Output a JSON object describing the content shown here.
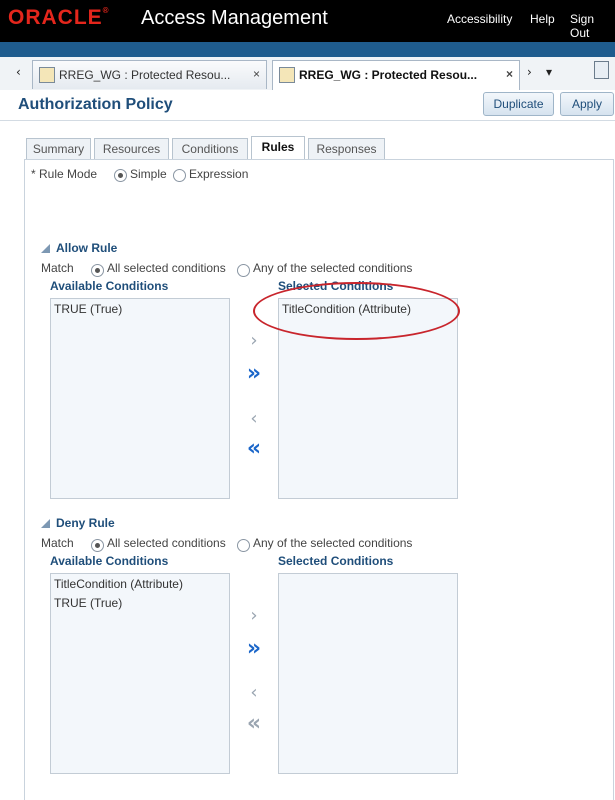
{
  "header": {
    "brand": "ORACLE",
    "product": "Access Management",
    "links": [
      "Accessibility",
      "Help",
      "Sign Out"
    ]
  },
  "doc_tabs": [
    {
      "label": "RREG_WG : Protected Resou...",
      "close": "×",
      "active": false
    },
    {
      "label": "RREG_WG : Protected Resou...",
      "close": "×",
      "active": true
    }
  ],
  "nav": {
    "prev": "‹",
    "next": "›",
    "menu": "▾"
  },
  "page": {
    "title": "Authorization Policy",
    "duplicate_label": "Duplicate",
    "apply_label": "Apply"
  },
  "sub_tabs": [
    "Summary",
    "Resources",
    "Conditions",
    "Rules",
    "Responses"
  ],
  "active_sub_tab": "Rules",
  "rule_mode": {
    "label": "* Rule Mode",
    "options": [
      "Simple",
      "Expression"
    ],
    "selected": "Simple"
  },
  "allow_rule": {
    "title": "Allow Rule",
    "match_label": "Match",
    "match_options": [
      "All selected conditions",
      "Any of the selected conditions"
    ],
    "match_selected": "All selected conditions",
    "available_header": "Available Conditions",
    "selected_header": "Selected Conditions",
    "available": [
      "TRUE (True)"
    ],
    "selected": [
      "TitleCondition (Attribute)"
    ]
  },
  "deny_rule": {
    "title": "Deny Rule",
    "match_label": "Match",
    "match_options": [
      "All selected conditions",
      "Any of the selected conditions"
    ],
    "match_selected": "All selected conditions",
    "available_header": "Available Conditions",
    "selected_header": "Selected Conditions",
    "available": [
      "TitleCondition (Attribute)",
      "TRUE (True)"
    ],
    "selected": []
  },
  "shuttle": {
    "move": "›",
    "move_all": "»",
    "remove": "‹",
    "remove_all": "«"
  },
  "colors": {
    "accent": "#1f4e7a",
    "brand_red": "#e4261c",
    "annotation": "#c8252c",
    "shuttle_active": "#1b66c9",
    "shuttle_disabled": "#9aa5b1"
  }
}
